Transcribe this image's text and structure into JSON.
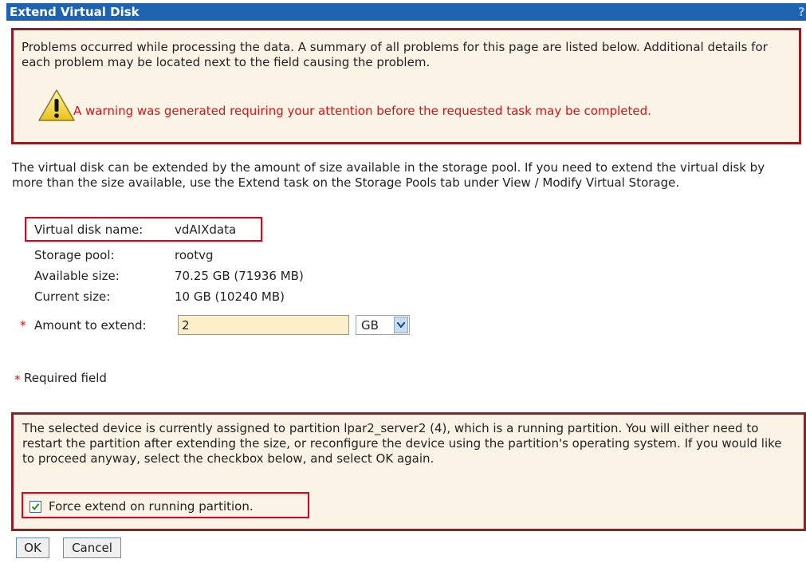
{
  "dialog": {
    "title": "Extend Virtual Disk",
    "help": "?"
  },
  "error_box": {
    "message": "Problems occurred while processing the data. A summary of all problems for this page are listed below. Additional details for each problem may be located next to the field causing the problem.",
    "warning": "A warning was generated requiring your attention before the requested task may be completed."
  },
  "intro": "The virtual disk can be extended by the amount of size available in the storage pool. If you need to extend the virtual disk by more than the size available, use the Extend task on the Storage Pools tab under View / Modify Virtual Storage.",
  "fields": [
    {
      "label": "Virtual disk name:",
      "value": "vdAIXdata"
    },
    {
      "label": "Storage pool:",
      "value": "rootvg"
    },
    {
      "label": "Available size:",
      "value": "70.25 GB (71936 MB)"
    },
    {
      "label": "Current size:",
      "value": "10 GB (10240 MB)"
    }
  ],
  "amount": {
    "required_marker": "*",
    "label": "Amount to extend:",
    "value": "2",
    "unit": "GB"
  },
  "required_note": {
    "marker": "*",
    "text": "Required field"
  },
  "notice": {
    "message": "The selected device is currently assigned to partition lpar2_server2 (4), which is a running partition. You will either need to restart the partition after extending the size, or reconfigure the device using the partition's operating system. If you would like to proceed anyway, select the checkbox below, and select OK again.",
    "checkbox_label": "Force extend on running partition.",
    "checked": true
  },
  "buttons": {
    "ok": "OK",
    "cancel": "Cancel"
  },
  "colors": {
    "title_bar": "#1f62b0",
    "error_border": "#8e1f24",
    "box_bg": "#fbf3e6",
    "warning_text": "#d01818",
    "highlight": "#e3001b",
    "input_bg": "#fcefc9"
  }
}
